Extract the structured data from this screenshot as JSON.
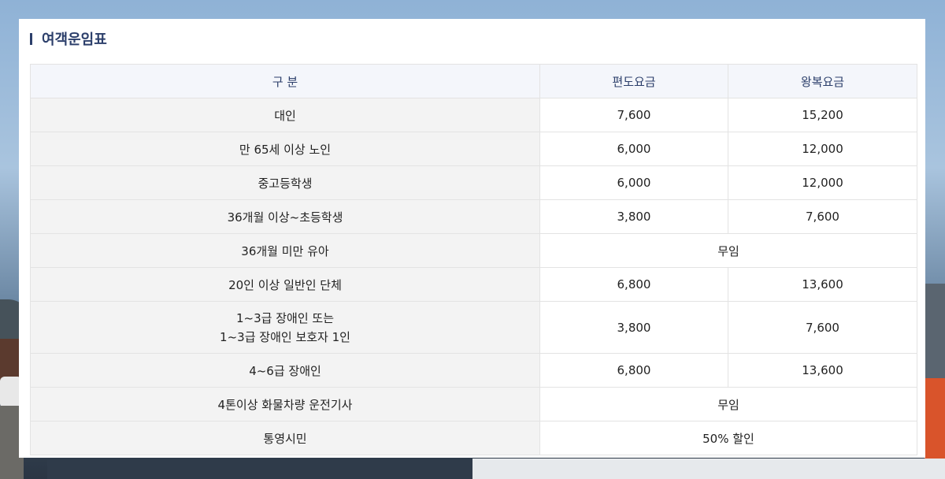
{
  "title": "여객운임표",
  "table": {
    "headers": [
      "구 분",
      "편도요금",
      "왕복요금"
    ],
    "rows": [
      {
        "category": "대인",
        "one_way": "7,600",
        "round_trip": "15,200"
      },
      {
        "category": "만 65세 이상 노인",
        "one_way": "6,000",
        "round_trip": "12,000"
      },
      {
        "category": "중고등학생",
        "one_way": "6,000",
        "round_trip": "12,000"
      },
      {
        "category": "36개월 이상~초등학생",
        "one_way": "3,800",
        "round_trip": "7,600"
      },
      {
        "category": "36개월 미만 유아",
        "merged": "무임"
      },
      {
        "category": "20인 이상 일반인 단체",
        "one_way": "6,800",
        "round_trip": "13,600"
      },
      {
        "category_line1": "1~3급 장애인 또는",
        "category_line2": "1~3급 장애인 보호자 1인",
        "one_way": "3,800",
        "round_trip": "7,600"
      },
      {
        "category": "4~6급 장애인",
        "one_way": "6,800",
        "round_trip": "13,600"
      },
      {
        "category": "4톤이상 화물차량 운전기사",
        "merged": "무임"
      },
      {
        "category": "통영시민",
        "merged": "50% 할인"
      }
    ]
  }
}
